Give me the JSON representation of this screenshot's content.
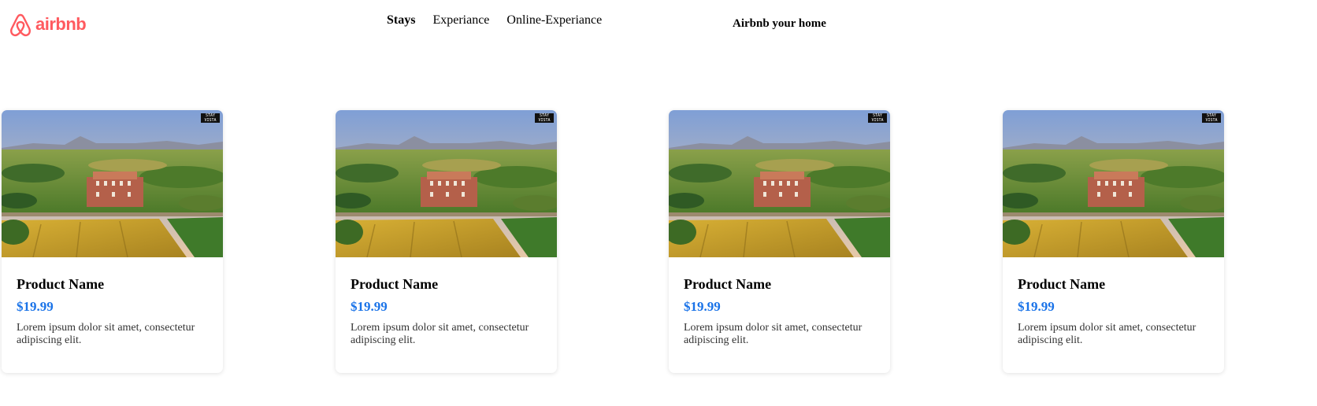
{
  "brand": {
    "name": "airbnb",
    "color": "#ff5a5f",
    "icon": "airbnb-belo-icon"
  },
  "nav": {
    "items": [
      {
        "label": "Stays",
        "active": true
      },
      {
        "label": "Experiance",
        "active": false
      },
      {
        "label": "Online-Experiance",
        "active": false
      }
    ]
  },
  "header": {
    "host_link": "Airbnb your home"
  },
  "products": [
    {
      "name": "Product Name",
      "price": "$19.99",
      "description": "Lorem ipsum dolor sit amet, consectetur adipiscing elit.",
      "image": "aerial-farmhouse-photo",
      "watermark": "STAY VISTA"
    },
    {
      "name": "Product Name",
      "price": "$19.99",
      "description": "Lorem ipsum dolor sit amet, consectetur adipiscing elit.",
      "image": "aerial-farmhouse-photo",
      "watermark": "STAY VISTA"
    },
    {
      "name": "Product Name",
      "price": "$19.99",
      "description": "Lorem ipsum dolor sit amet, consectetur adipiscing elit.",
      "image": "aerial-farmhouse-photo",
      "watermark": "STAY VISTA"
    },
    {
      "name": "Product Name",
      "price": "$19.99",
      "description": "Lorem ipsum dolor sit amet, consectetur adipiscing elit.",
      "image": "aerial-farmhouse-photo",
      "watermark": "STAY VISTA"
    }
  ],
  "colors": {
    "price": "#1a73e8",
    "brand": "#ff5a5f"
  }
}
